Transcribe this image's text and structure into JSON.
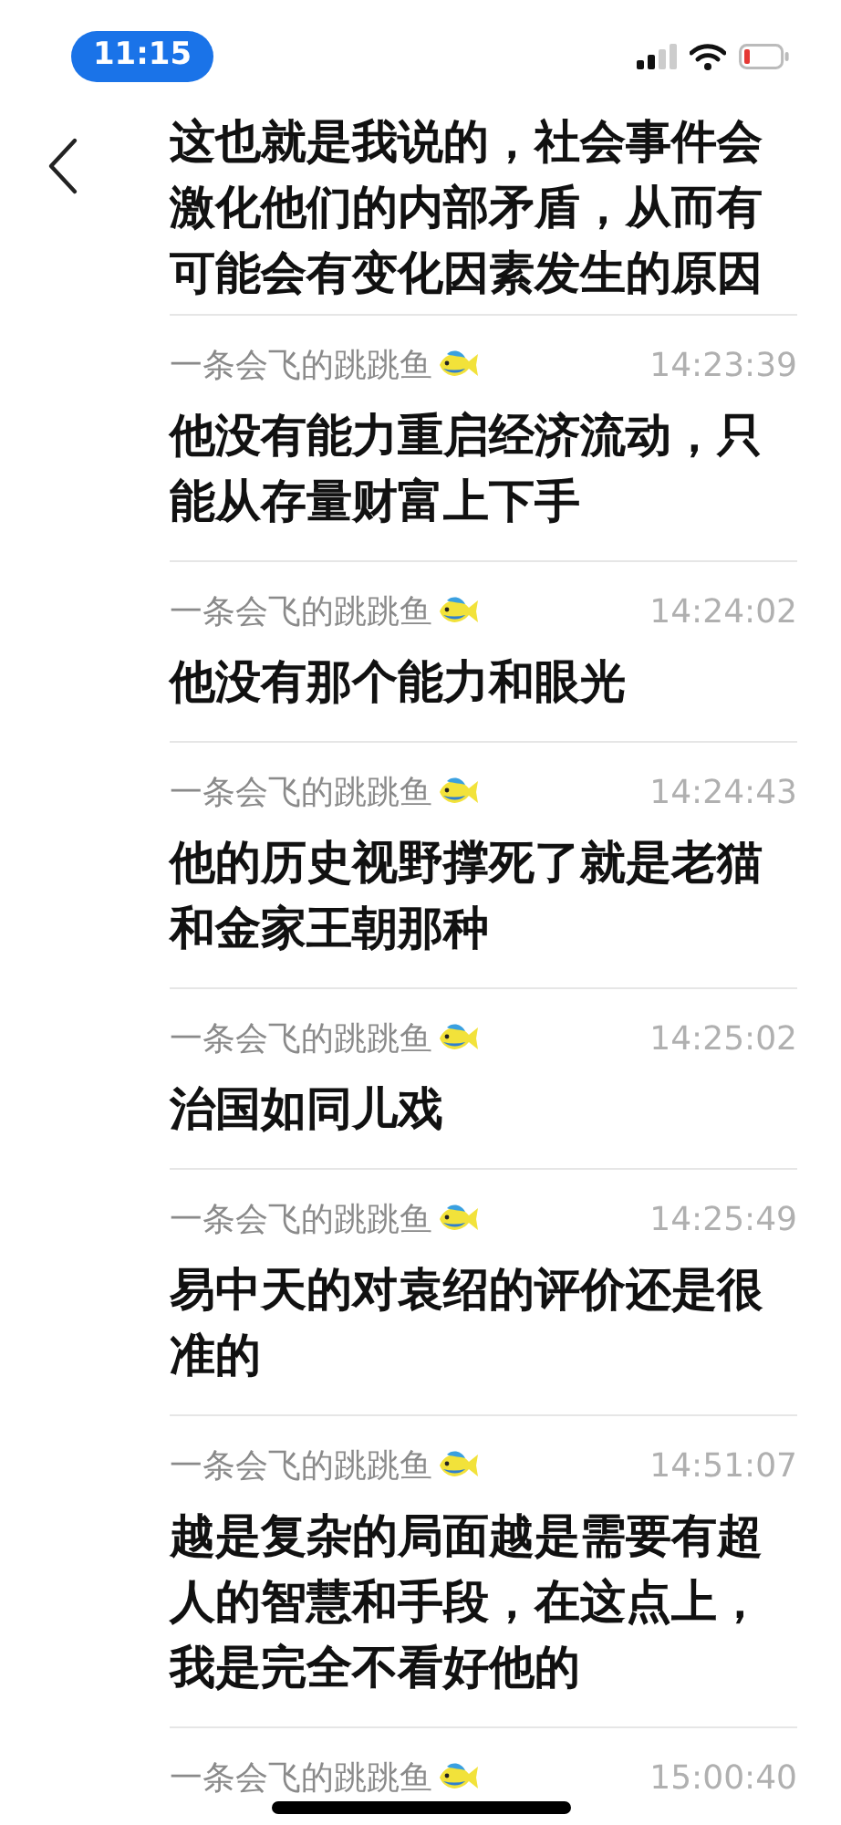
{
  "status_bar": {
    "time": "11:15"
  },
  "messages": [
    {
      "text": "这也就是我说的，社会事件会激化他们的内部矛盾，从而有可能会有变化因素发生的原因"
    },
    {
      "sender": "一条会飞的跳跳鱼",
      "time": "14:23:39",
      "text": "他没有能力重启经济流动，只能从存量财富上下手"
    },
    {
      "sender": "一条会飞的跳跳鱼",
      "time": "14:24:02",
      "text": "他没有那个能力和眼光"
    },
    {
      "sender": "一条会飞的跳跳鱼",
      "time": "14:24:43",
      "text": "他的历史视野撑死了就是老猫和金家王朝那种"
    },
    {
      "sender": "一条会飞的跳跳鱼",
      "time": "14:25:02",
      "text": "治国如同儿戏"
    },
    {
      "sender": "一条会飞的跳跳鱼",
      "time": "14:25:49",
      "text": "易中天的对袁绍的评价还是很准的"
    },
    {
      "sender": "一条会飞的跳跳鱼",
      "time": "14:51:07",
      "text": "越是复杂的局面越是需要有超人的智慧和手段，在这点上，我是完全不看好他的"
    },
    {
      "sender": "一条会飞的跳跳鱼",
      "time": "15:00:40"
    }
  ]
}
